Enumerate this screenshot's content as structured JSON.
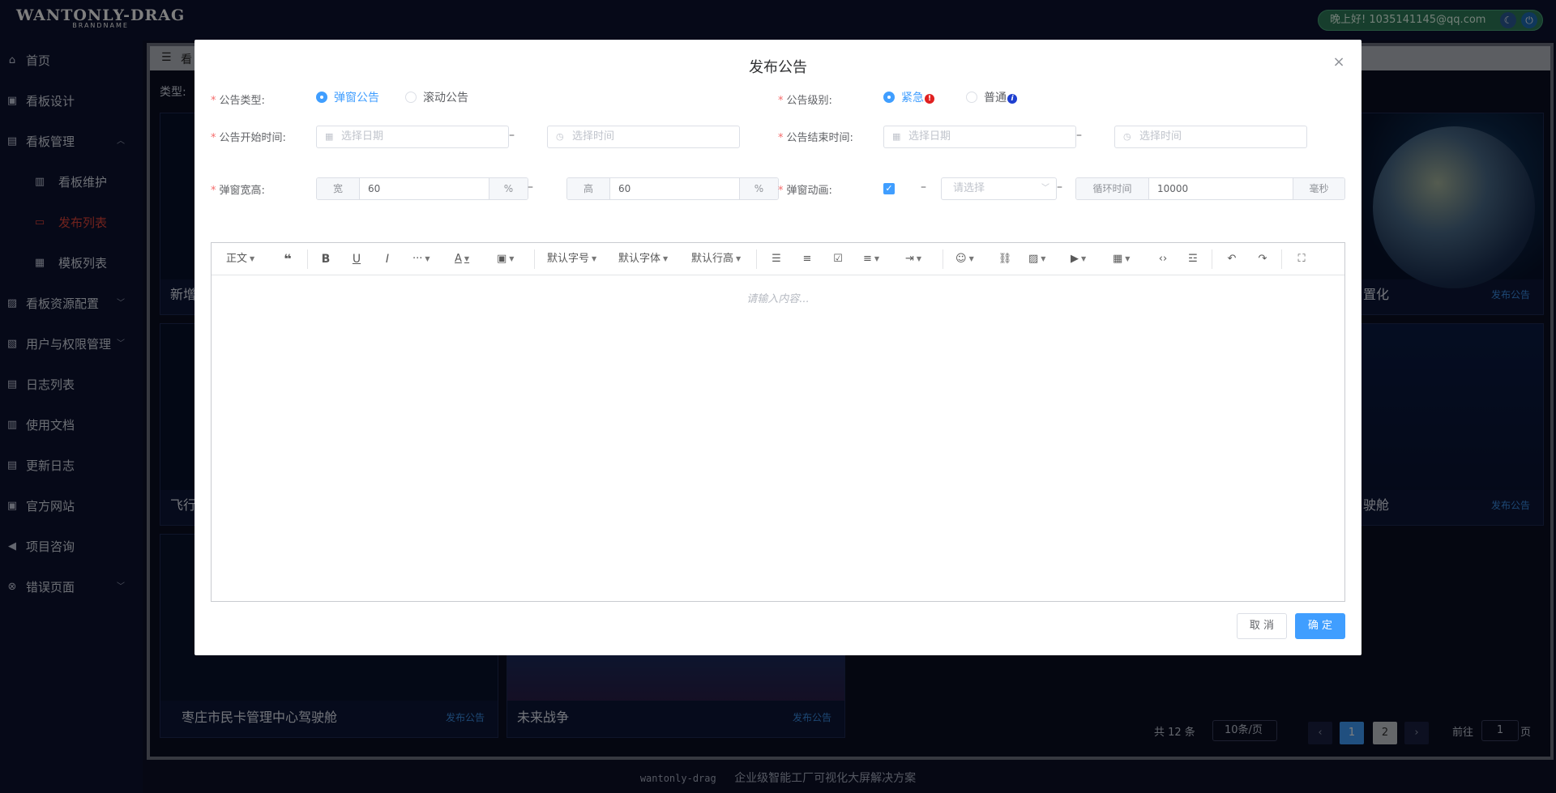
{
  "brand": {
    "name": "WANTONLY-DRAG",
    "sub": "BRANDNAME"
  },
  "user": {
    "greeting": "晚上好! 1035141145@qq.com"
  },
  "sidebar": {
    "items": [
      {
        "label": "首页",
        "icon": "home-icon",
        "glyph": "⌂"
      },
      {
        "label": "看板设计",
        "icon": "design-icon",
        "glyph": "▣"
      },
      {
        "label": "看板管理",
        "icon": "board-manage-icon",
        "glyph": "▤",
        "arrow": "︿"
      },
      {
        "label": "看板维护",
        "icon": "chart-icon",
        "glyph": "▥",
        "sub": true
      },
      {
        "label": "发布列表",
        "icon": "monitor-icon",
        "glyph": "▭",
        "sub": true,
        "active": true
      },
      {
        "label": "模板列表",
        "icon": "template-icon",
        "glyph": "▦",
        "sub": true
      },
      {
        "label": "看板资源配置",
        "icon": "resource-icon",
        "glyph": "▨",
        "arrow": "﹀"
      },
      {
        "label": "用户与权限管理",
        "icon": "user-icon",
        "glyph": "▧",
        "arrow": "﹀"
      },
      {
        "label": "日志列表",
        "icon": "log-icon",
        "glyph": "▤"
      },
      {
        "label": "使用文档",
        "icon": "doc-icon",
        "glyph": "▥"
      },
      {
        "label": "更新日志",
        "icon": "update-icon",
        "glyph": "▤"
      },
      {
        "label": "官方网站",
        "icon": "website-icon",
        "glyph": "▣"
      },
      {
        "label": "项目咨询",
        "icon": "megaphone-icon",
        "glyph": "◀"
      },
      {
        "label": "错误页面",
        "icon": "error-icon",
        "glyph": "⊗",
        "arrow": "﹀"
      }
    ]
  },
  "content": {
    "tab_label": "看",
    "type_label": "类型:",
    "cards": [
      {
        "title": "新增",
        "link": ""
      },
      {
        "title": "置化",
        "link": "发布公告"
      },
      {
        "title": "飞行",
        "link": ""
      },
      {
        "title": "驶舱",
        "link": "发布公告"
      },
      {
        "title": "枣庄市民卡管理中心驾驶舱",
        "link": "发布公告"
      },
      {
        "title": "未来战争",
        "link": "发布公告"
      }
    ],
    "pager": {
      "total": "共 12 条",
      "page_size": "10条/页",
      "prev": "‹",
      "pages": [
        "1",
        "2"
      ],
      "next": "›",
      "goto_prefix": "前往",
      "goto_value": "1",
      "goto_suffix": "页"
    }
  },
  "footer": {
    "brand": "wantonly-drag",
    "slogan": "企业级智能工厂可视化大屏解决方案"
  },
  "dialog": {
    "title": "发布公告",
    "close": "×",
    "type": {
      "label": "公告类型:",
      "options": [
        "弹窗公告",
        "滚动公告"
      ],
      "selected": 0
    },
    "level": {
      "label": "公告级别:",
      "options": [
        "紧急",
        "普通"
      ],
      "selected": 0,
      "badges": [
        "!",
        "i"
      ]
    },
    "start": {
      "label": "公告开始时间:",
      "date_placeholder": "选择日期",
      "time_placeholder": "选择时间"
    },
    "end": {
      "label": "公告结束时间:",
      "date_placeholder": "选择日期",
      "time_placeholder": "选择时间"
    },
    "size": {
      "label": "弹窗宽高:",
      "width_prefix": "宽",
      "width_value": "60",
      "width_suffix": "%",
      "height_prefix": "高",
      "height_value": "60",
      "height_suffix": "%"
    },
    "anim": {
      "label": "弹窗动画:",
      "checked": true,
      "select_placeholder": "请选择",
      "loop_prefix": "循环时间",
      "loop_value": "10000",
      "loop_suffix": "毫秒"
    },
    "editor": {
      "placeholder": "请输入内容...",
      "toolbar": {
        "paragraph": "正文",
        "font_size": "默认字号",
        "font_family": "默认字体",
        "line_height": "默认行高"
      }
    },
    "cancel": "取 消",
    "confirm": "确 定"
  },
  "colors": {
    "primary": "#409eff",
    "danger": "#f56c6c",
    "active_nav": "#e0453a",
    "urgent_badge": "#e02020",
    "normal_badge": "#1e3fd0"
  }
}
